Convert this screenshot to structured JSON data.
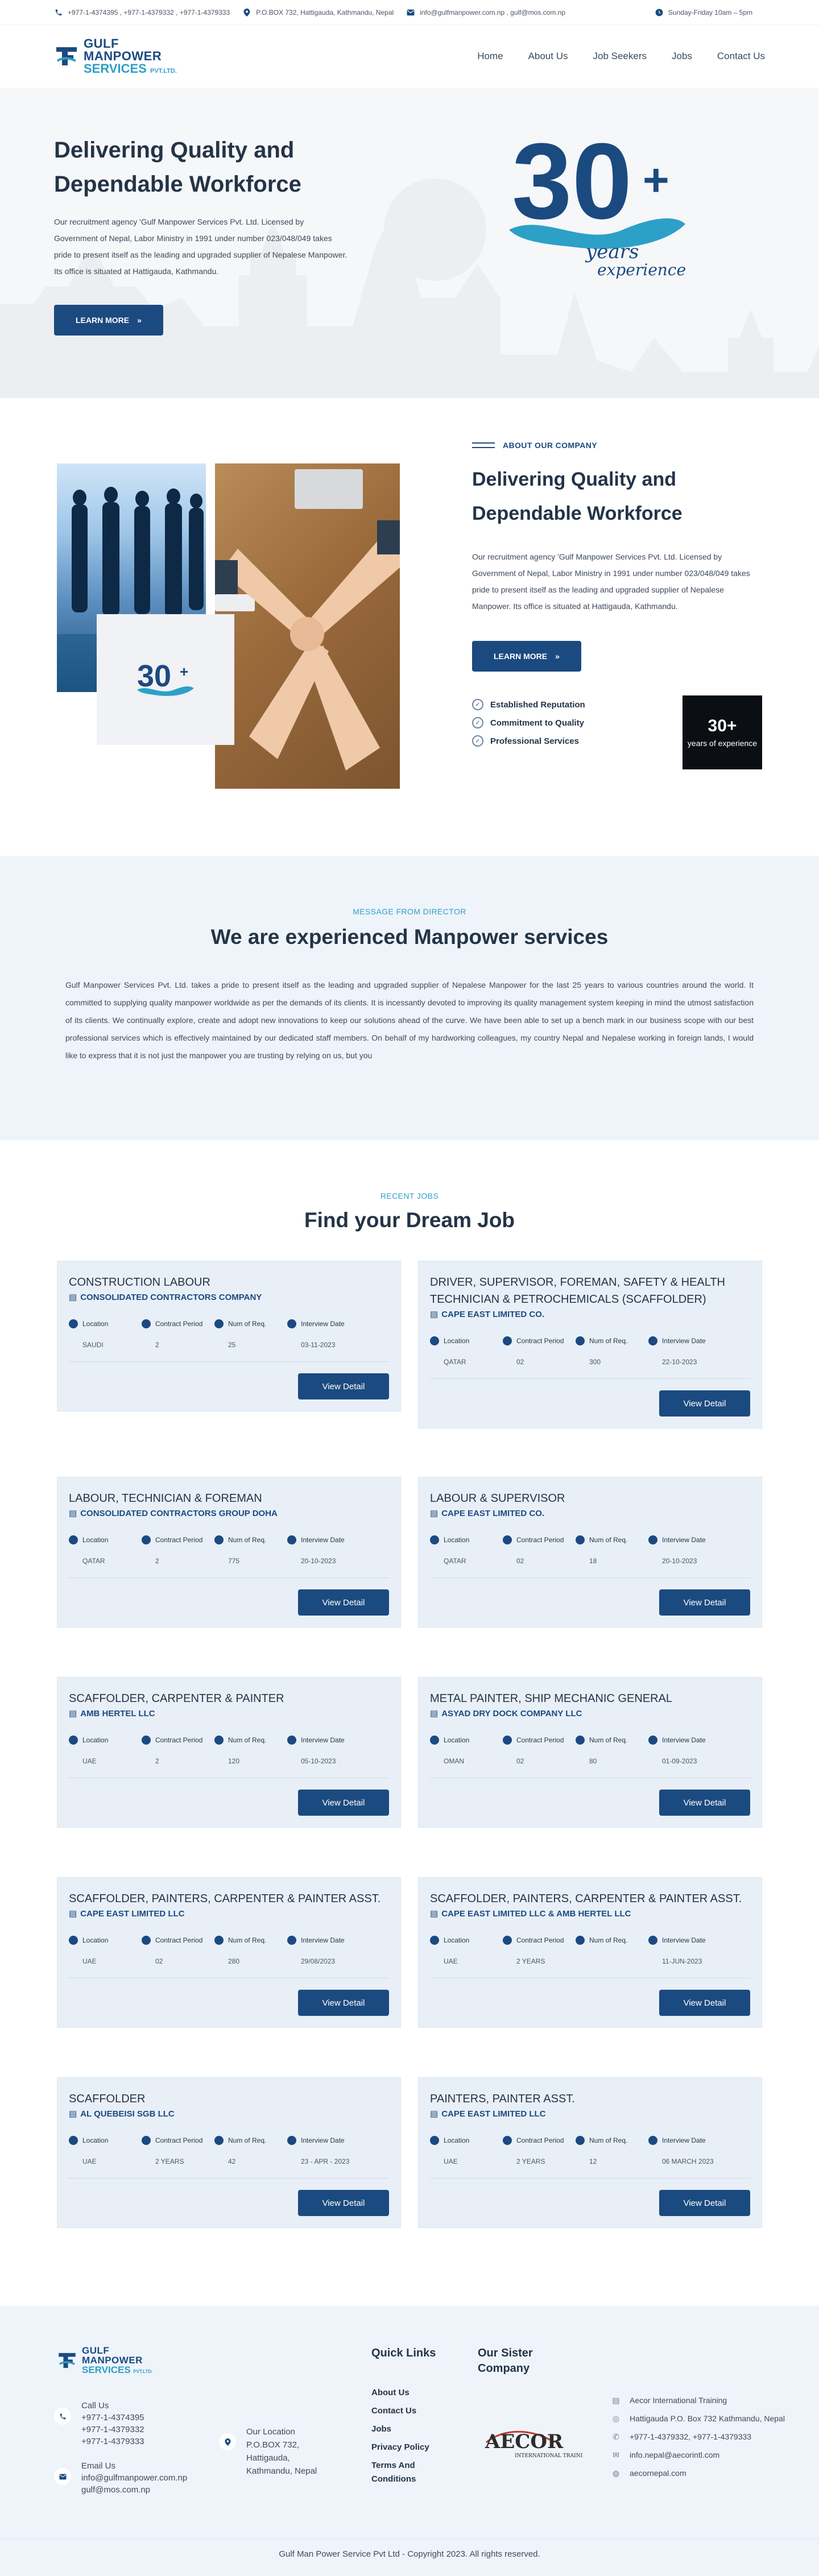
{
  "topbar": {
    "phone": "+977-1-4374395 , +977-1-4379332 , +977-1-4379333",
    "address": "P.O.BOX 732, Hattigauda, Kathmandu, Nepal",
    "email": "info@gulfmanpower.com.np , gulf@mos.com.np",
    "hours": "Sunday-Friday 10am – 5pm"
  },
  "logo": {
    "line1": "GULF",
    "line2": "MANPOWER",
    "line3": "SERVICES",
    "suffix": "PVT.LTD."
  },
  "nav": [
    "Home",
    "About Us",
    "Job Seekers",
    "Jobs",
    "Contact Us"
  ],
  "hero": {
    "title": "Delivering Quality and Dependable Workforce",
    "text": "Our recruitment agency 'Gulf Manpower Services Pvt. Ltd. Licensed by Government of Nepal, Labor Ministry in 1991 under number 023/048/049 takes pride to present itself as the leading and upgraded supplier of Nepalese Manpower. Its office is situated at Hattigauda, Kathmandu.",
    "button": "LEARN MORE",
    "badge_number": "30",
    "badge_plus": "+",
    "badge_years": "years",
    "badge_experience": "experience"
  },
  "about": {
    "eyebrow": "ABOUT OUR COMPANY",
    "title": "Delivering Quality and Dependable Workforce",
    "text": "Our recruitment agency 'Gulf Manpower Services Pvt. Ltd. Licensed by Government of Nepal, Labor Ministry in 1991 under number 023/048/049 takes pride to present itself as the leading and upgraded supplier of Nepalese Manpower. Its office is situated at Hattigauda, Kathmandu.",
    "button": "LEARN MORE",
    "features": [
      "Established Reputation",
      "Commitment to Quality",
      "Professional Services"
    ],
    "years_big": "30+",
    "years_small": "years of experience"
  },
  "director": {
    "eyebrow": "MESSAGE FROM DIRECTOR",
    "title": "We are experienced Manpower services",
    "text": "Gulf Manpower Services Pvt. Ltd. takes a pride to present itself as the leading and upgraded supplier of Nepalese Manpower for the last 25 years to various countries around the world. It committed to supplying quality manpower worldwide as per the demands of its clients. It is incessantly devoted to improving its quality management system keeping in mind the utmost satisfaction of its clients. We continually explore, create and adopt new innovations to keep our solutions ahead of the curve. We have been able to set up a bench mark in our business scope with our best professional services which is effectively maintained by our dedicated staff members. On behalf of my hardworking colleagues, my country Nepal and Nepalese working in foreign lands, I would like to express that it is not just the manpower you are trusting by relying on us, but you"
  },
  "jobs": {
    "eyebrow": "RECENT JOBS",
    "title": "Find your Dream Job",
    "labels": {
      "location": "Location",
      "contract": "Contract Period",
      "num": "Num of Req.",
      "interview": "Interview Date"
    },
    "button": "View Detail",
    "items": [
      {
        "title": "CONSTRUCTION LABOUR",
        "company": "CONSOLIDATED CONTRACTORS COMPANY",
        "location": "SAUDI",
        "contract": "2",
        "num": "25",
        "interview": "03-11-2023"
      },
      {
        "title": "DRIVER, SUPERVISOR, FOREMAN, SAFETY & HEALTH TECHNICIAN & PETROCHEMICALS (SCAFFOLDER)",
        "company": "CAPE EAST LIMITED CO.",
        "location": "QATAR",
        "contract": "02",
        "num": "300",
        "interview": "22-10-2023"
      },
      {
        "title": "LABOUR, TECHNICIAN & FOREMAN",
        "company": "CONSOLIDATED CONTRACTORS GROUP DOHA",
        "location": "QATAR",
        "contract": "2",
        "num": "775",
        "interview": "20-10-2023"
      },
      {
        "title": "LABOUR & SUPERVISOR",
        "company": "CAPE EAST LIMITED CO.",
        "location": "QATAR",
        "contract": "02",
        "num": "18",
        "interview": "20-10-2023"
      },
      {
        "title": "SCAFFOLDER, CARPENTER & PAINTER",
        "company": "AMB HERTEL LLC",
        "location": "UAE",
        "contract": "2",
        "num": "120",
        "interview": "05-10-2023"
      },
      {
        "title": "METAL PAINTER, SHIP MECHANIC GENERAL",
        "company": "ASYAD DRY DOCK COMPANY LLC",
        "location": "OMAN",
        "contract": "02",
        "num": "80",
        "interview": "01-09-2023"
      },
      {
        "title": "SCAFFOLDER, PAINTERS, CARPENTER & PAINTER ASST.",
        "company": "CAPE EAST LIMITED LLC",
        "location": "UAE",
        "contract": "02",
        "num": "280",
        "interview": "29/08/2023"
      },
      {
        "title": "SCAFFOLDER, PAINTERS, CARPENTER & PAINTER ASST.",
        "company": "CAPE EAST LIMITED LLC & AMB HERTEL LLC",
        "location": "UAE",
        "contract": "2 YEARS",
        "num": "",
        "interview": "11-JUN-2023"
      },
      {
        "title": "SCAFFOLDER",
        "company": "AL QUEBEISI SGB LLC",
        "location": "UAE",
        "contract": "2 YEARS",
        "num": "42",
        "interview": "23 - APR - 2023"
      },
      {
        "title": "PAINTERS, PAINTER ASST.",
        "company": "CAPE EAST LIMITED LLC",
        "location": "UAE",
        "contract": "2 YEARS",
        "num": "12",
        "interview": "06 MARCH 2023"
      }
    ]
  },
  "footer": {
    "call_label": "Call Us",
    "phones": [
      "+977-1-4374395",
      "+977-1-4379332",
      "+977-1-4379333"
    ],
    "email_label": "Email Us",
    "emails": [
      "info@gulfmanpower.com.np",
      "gulf@mos.com.np"
    ],
    "location_label": "Our Location",
    "location_lines": [
      "P.O.BOX 732,",
      "Hattigauda,",
      "Kathmandu, Nepal"
    ],
    "quick_title": "Quick Links",
    "quick_links": [
      "About Us",
      "Contact Us",
      "Jobs",
      "Privacy Policy",
      "Terms And Conditions"
    ],
    "sister_title": "Our Sister Company",
    "aecor_name": "AECOR",
    "aecor_sub": "INTERNATIONAL TRAINING",
    "aecor_info": [
      "Aecor International Training",
      "Hattigauda P.O. Box 732 Kathmandu, Nepal",
      "+977-1-4379332, +977-1-4379333",
      "info.nepal@aecorintl.com",
      "aecornepal.com"
    ],
    "copyright": "Gulf Man Power Service Pvt Ltd - Copyright 2023. All rights reserved."
  },
  "colors": {
    "primary": "#1b4a80",
    "accent": "#2da0c7",
    "panel": "#eef4fa"
  }
}
